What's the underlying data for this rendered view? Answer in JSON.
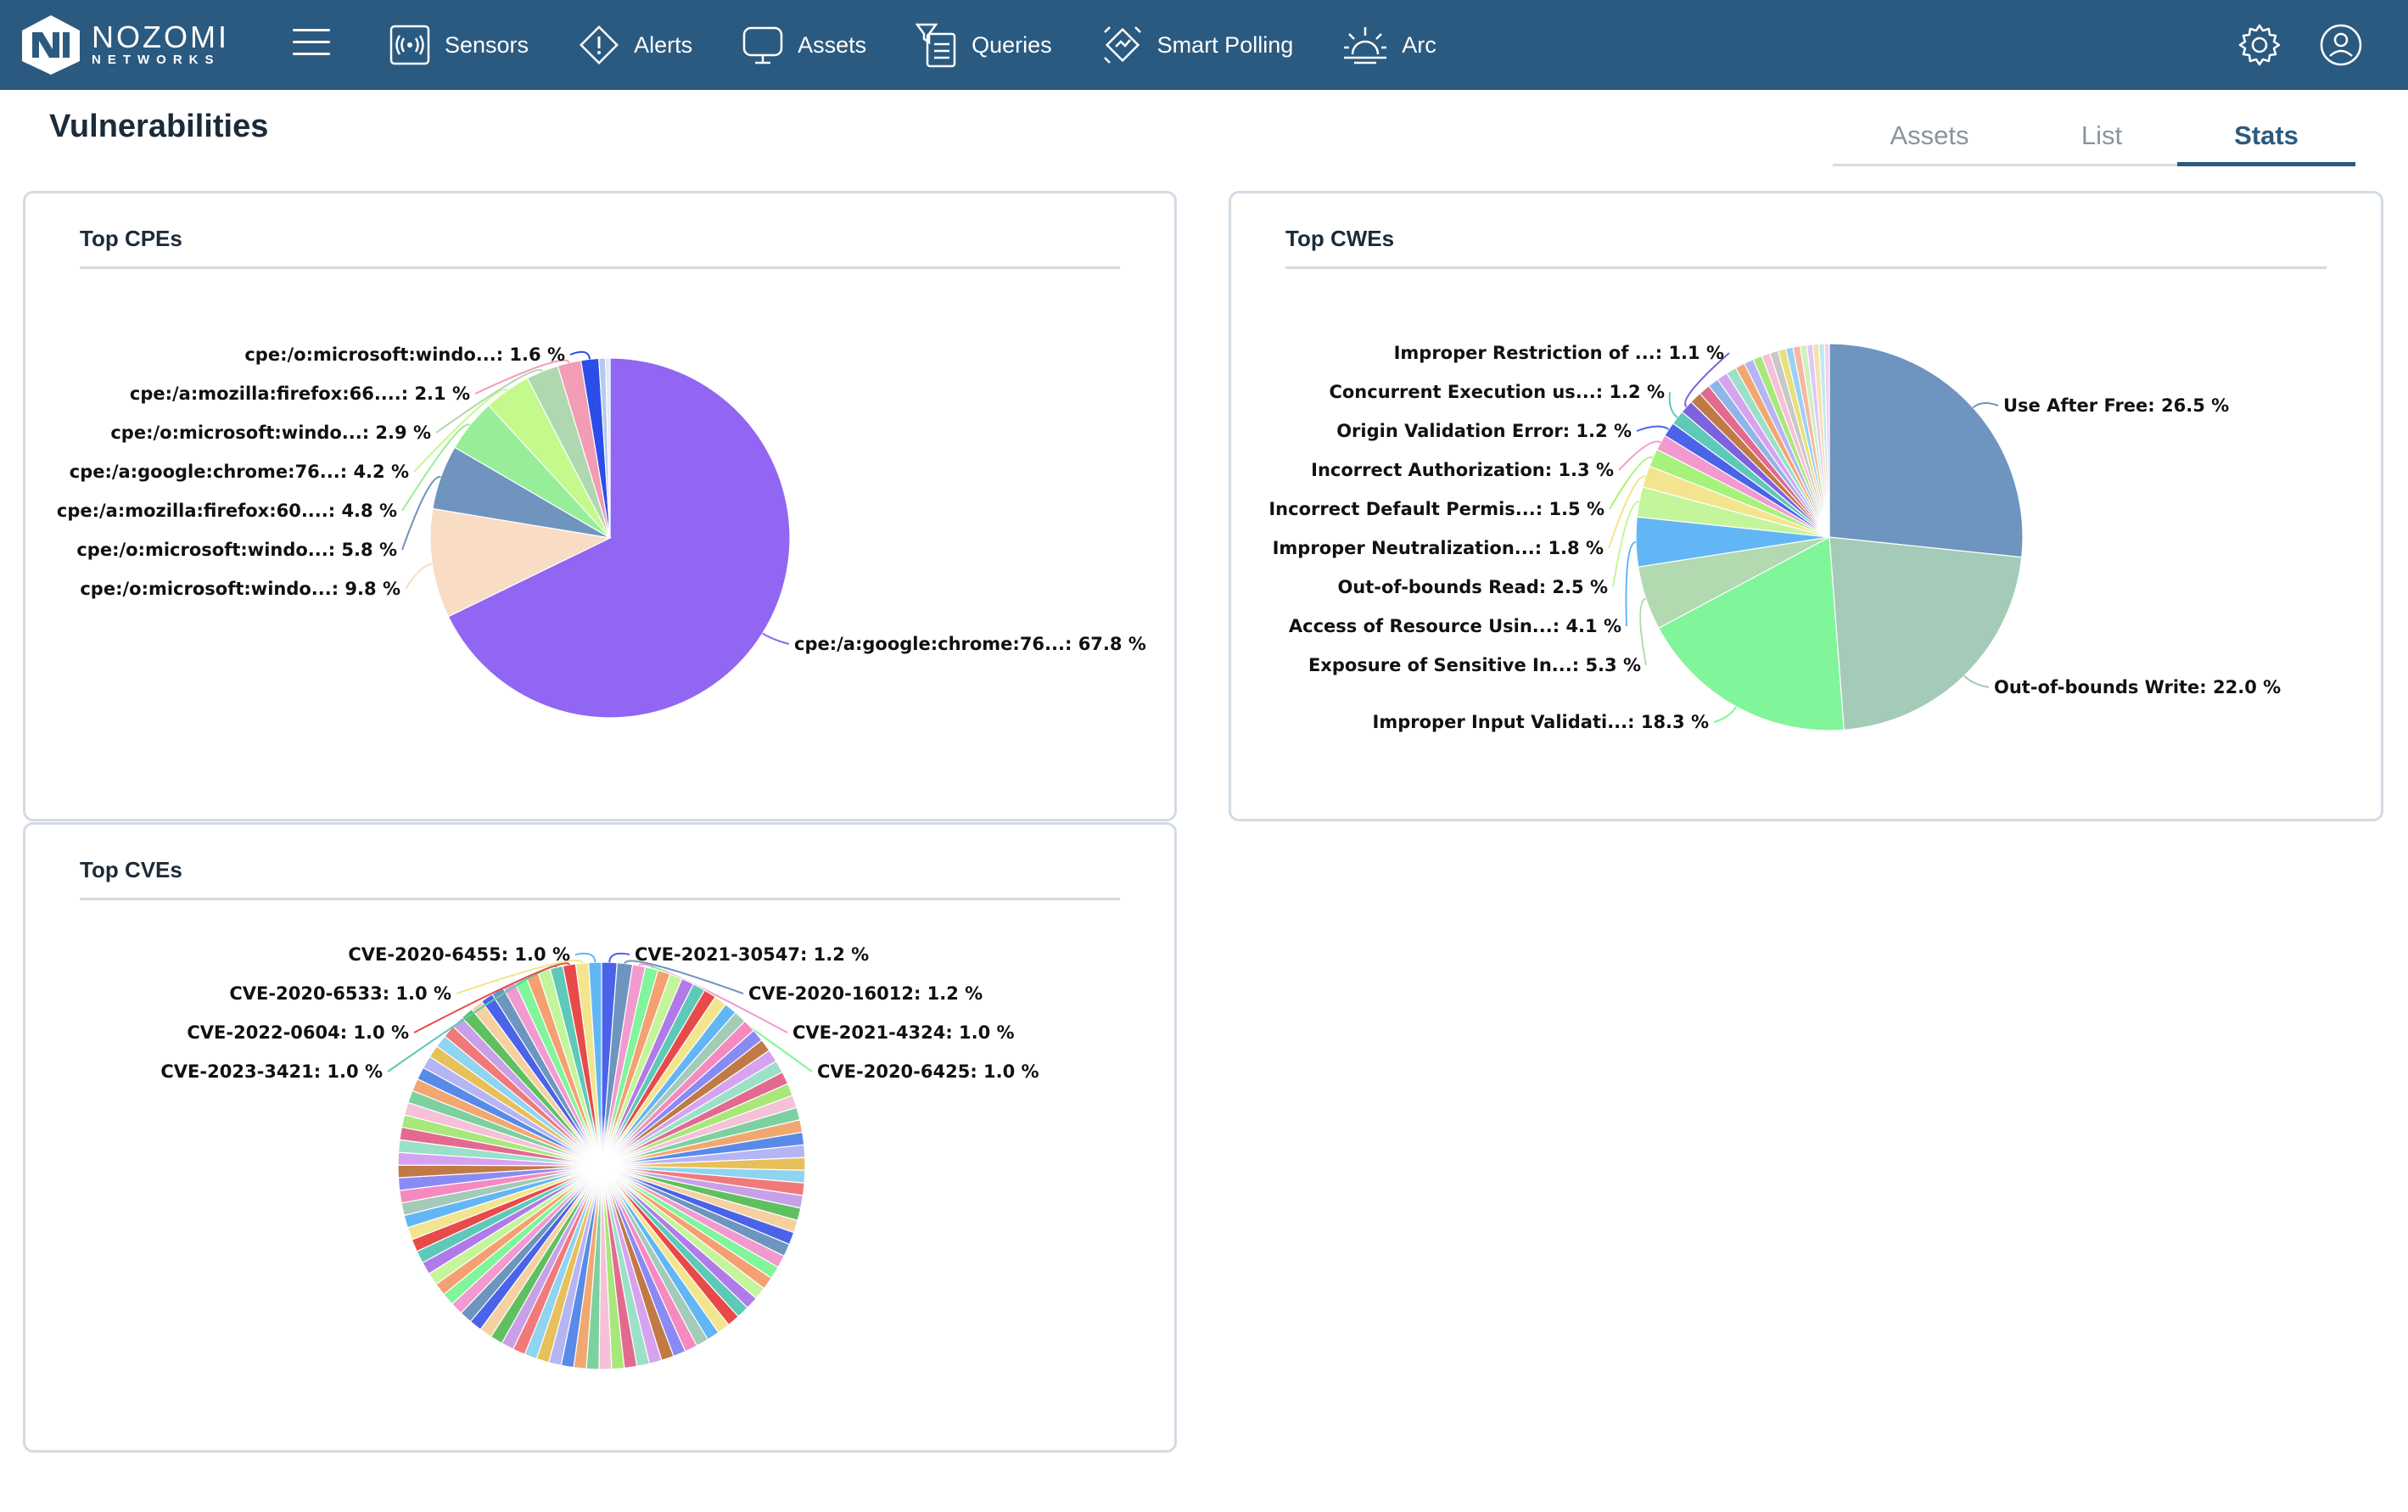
{
  "app": {
    "brand_name": "NOZOMI",
    "brand_sub": "NETWORKS"
  },
  "nav": {
    "items": [
      {
        "label": "Sensors",
        "icon": "sensors-icon"
      },
      {
        "label": "Alerts",
        "icon": "alert-icon"
      },
      {
        "label": "Assets",
        "icon": "monitor-icon"
      },
      {
        "label": "Queries",
        "icon": "queries-icon"
      },
      {
        "label": "Smart Polling",
        "icon": "smart-polling-icon"
      },
      {
        "label": "Arc",
        "icon": "arc-icon"
      }
    ],
    "right_icons": [
      "gear-icon",
      "user-icon"
    ]
  },
  "page": {
    "title": "Vulnerabilities",
    "tabs": [
      {
        "label": "Assets",
        "active": false
      },
      {
        "label": "List",
        "active": false
      },
      {
        "label": "Stats",
        "active": true
      }
    ]
  },
  "chart_data": [
    {
      "id": "cpes",
      "type": "pie",
      "title": "Top CPEs",
      "slices": [
        {
          "label": "cpe:/a:google:chrome:76...",
          "value": 67.8,
          "color": "#9166f2",
          "show_label": true
        },
        {
          "label": "cpe:/o:microsoft:windo...",
          "value": 9.8,
          "color": "#f8dcc4",
          "show_label": true
        },
        {
          "label": "cpe:/o:microsoft:windo...",
          "value": 5.8,
          "color": "#6f94bd",
          "show_label": true
        },
        {
          "label": "cpe:/a:mozilla:firefox:60....",
          "value": 4.8,
          "color": "#98ee98",
          "show_label": true
        },
        {
          "label": "cpe:/a:google:chrome:76...",
          "value": 4.2,
          "color": "#c4f98c",
          "show_label": true
        },
        {
          "label": "cpe:/o:microsoft:windo...",
          "value": 2.9,
          "color": "#b0d8b0",
          "show_label": true
        },
        {
          "label": "cpe:/a:mozilla:firefox:66....",
          "value": 2.1,
          "color": "#f29cb5",
          "show_label": true
        },
        {
          "label": "cpe:/o:microsoft:windo...",
          "value": 1.6,
          "color": "#2b4de8",
          "show_label": true
        },
        {
          "label": "",
          "value": 0.6,
          "color": "#b7c9ee",
          "show_label": false
        },
        {
          "label": "",
          "value": 0.4,
          "color": "#e0e8f4",
          "show_label": false
        }
      ]
    },
    {
      "id": "cwes",
      "type": "pie",
      "title": "Top CWEs",
      "slices": [
        {
          "label": "Use After Free",
          "value": 26.5,
          "color": "#6d95bf",
          "show_label": true
        },
        {
          "label": "Out-of-bounds Write",
          "value": 22.0,
          "color": "#a3cbb8",
          "show_label": true
        },
        {
          "label": "Improper Input Validati...",
          "value": 18.3,
          "color": "#80f59a",
          "show_label": true
        },
        {
          "label": "Exposure of Sensitive In...",
          "value": 5.3,
          "color": "#b2d9b0",
          "show_label": true
        },
        {
          "label": "Access of Resource Usin...",
          "value": 4.1,
          "color": "#63b6f5",
          "show_label": true
        },
        {
          "label": "Out-of-bounds Read",
          "value": 2.5,
          "color": "#c4f59a",
          "show_label": true
        },
        {
          "label": "Improper Neutralization...",
          "value": 1.8,
          "color": "#f2e58d",
          "show_label": true
        },
        {
          "label": "Incorrect Default Permis...",
          "value": 1.5,
          "color": "#a7f27a",
          "show_label": true
        },
        {
          "label": "Incorrect Authorization",
          "value": 1.3,
          "color": "#f29ad0",
          "show_label": true
        },
        {
          "label": "Origin Validation Error",
          "value": 1.2,
          "color": "#4a63e8",
          "show_label": true
        },
        {
          "label": "Concurrent Execution us...",
          "value": 1.2,
          "color": "#5ec9b8",
          "show_label": true
        },
        {
          "label": "Improper Restriction of ...",
          "value": 1.1,
          "color": "#7d62e0",
          "show_label": true
        },
        {
          "label": "",
          "value": 1.0,
          "color": "#c07a45",
          "show_label": false
        },
        {
          "label": "",
          "value": 0.95,
          "color": "#e36a8f",
          "show_label": false
        },
        {
          "label": "",
          "value": 0.9,
          "color": "#8fb5e8",
          "show_label": false
        },
        {
          "label": "",
          "value": 0.9,
          "color": "#d6a3f0",
          "show_label": false
        },
        {
          "label": "",
          "value": 0.85,
          "color": "#9be0c8",
          "show_label": false
        },
        {
          "label": "",
          "value": 0.8,
          "color": "#f0a870",
          "show_label": false
        },
        {
          "label": "",
          "value": 0.8,
          "color": "#b5b5f5",
          "show_label": false
        },
        {
          "label": "",
          "value": 0.75,
          "color": "#a8e87a",
          "show_label": false
        },
        {
          "label": "",
          "value": 0.7,
          "color": "#f5c0d8",
          "show_label": false
        },
        {
          "label": "",
          "value": 0.7,
          "color": "#c8c8c8",
          "show_label": false
        },
        {
          "label": "",
          "value": 0.65,
          "color": "#e8e07a",
          "show_label": false
        },
        {
          "label": "",
          "value": 0.6,
          "color": "#9ad0f5",
          "show_label": false
        },
        {
          "label": "",
          "value": 0.6,
          "color": "#f5b8a0",
          "show_label": false
        },
        {
          "label": "",
          "value": 0.55,
          "color": "#d0f0c0",
          "show_label": false
        },
        {
          "label": "",
          "value": 0.5,
          "color": "#e0c8f5",
          "show_label": false
        },
        {
          "label": "",
          "value": 0.5,
          "color": "#f5e0b0",
          "show_label": false
        },
        {
          "label": "",
          "value": 0.45,
          "color": "#c0e8f0",
          "show_label": false
        },
        {
          "label": "",
          "value": 0.4,
          "color": "#f0d0e8",
          "show_label": false
        }
      ]
    },
    {
      "id": "cves",
      "type": "pie",
      "title": "Top CVEs",
      "labeled_slices": [
        {
          "label": "CVE-2021-30547",
          "value": 1.2
        },
        {
          "label": "CVE-2020-16012",
          "value": 1.2
        },
        {
          "label": "CVE-2021-4324",
          "value": 1.0
        },
        {
          "label": "CVE-2020-6425",
          "value": 1.0
        },
        {
          "label": "CVE-2023-3421",
          "value": 1.0
        },
        {
          "label": "CVE-2022-0604",
          "value": 1.0
        },
        {
          "label": "CVE-2020-6533",
          "value": 1.0
        },
        {
          "label": "CVE-2020-6455",
          "value": 1.0
        }
      ],
      "unlabeled_slice_count": 92,
      "unlabeled_slice_value": 0.9783,
      "palette": [
        "#4a63e8",
        "#6d95bf",
        "#f29ad0",
        "#80f59a",
        "#f5a070",
        "#c4f59a",
        "#b07ae8",
        "#5ec9b8",
        "#e84a4a",
        "#f2e58d",
        "#63b6f5",
        "#a3cbb8",
        "#f58ac0",
        "#8a8af5",
        "#c07a45",
        "#d6a3f0",
        "#9be0c8",
        "#e36a8f",
        "#a8e87a",
        "#f5c0d8",
        "#7dd0a0",
        "#f0a870",
        "#5a8ae8",
        "#b5b5f5",
        "#e8c05a",
        "#8fd4f0",
        "#f07a7a",
        "#c8a0e8",
        "#60c060",
        "#f5d0a0"
      ]
    }
  ]
}
